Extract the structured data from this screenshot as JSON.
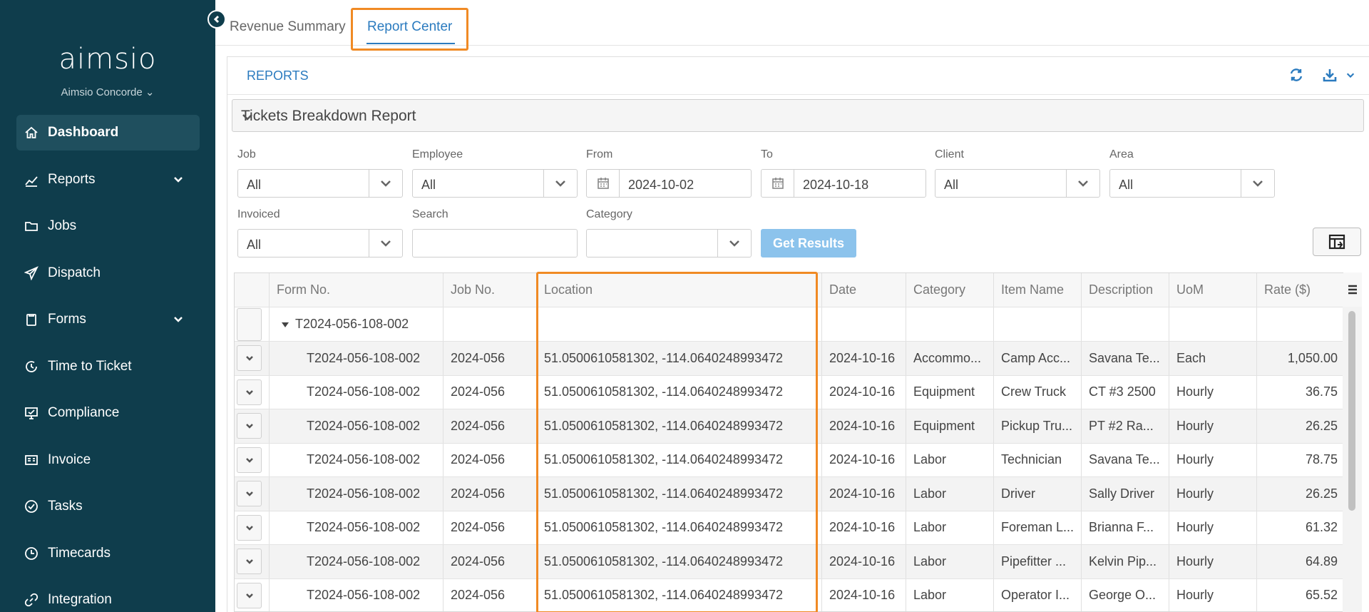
{
  "app": {
    "logo": "aimsio",
    "org": "Aimsio Concorde ⌄"
  },
  "sidebar": {
    "items": [
      {
        "label": "Dashboard",
        "icon": "home-icon",
        "active": true
      },
      {
        "label": "Reports",
        "icon": "chart-icon",
        "expandable": true
      },
      {
        "label": "Jobs",
        "icon": "folder-icon"
      },
      {
        "label": "Dispatch",
        "icon": "send-icon"
      },
      {
        "label": "Forms",
        "icon": "clipboard-icon",
        "expandable": true
      },
      {
        "label": "Time to Ticket",
        "icon": "clock-arrow-icon"
      },
      {
        "label": "Compliance",
        "icon": "monitor-check-icon"
      },
      {
        "label": "Invoice",
        "icon": "invoice-icon"
      },
      {
        "label": "Tasks",
        "icon": "check-circle-icon"
      },
      {
        "label": "Timecards",
        "icon": "clock-icon"
      },
      {
        "label": "Integration",
        "icon": "link-icon"
      }
    ]
  },
  "tabs": {
    "t1": "Revenue Summary",
    "t2": "Report Center"
  },
  "panel": {
    "title": "REPORTS",
    "report": "Tickets Breakdown Report"
  },
  "filters": {
    "job": {
      "label": "Job",
      "value": "All"
    },
    "employee": {
      "label": "Employee",
      "value": "All"
    },
    "from": {
      "label": "From",
      "value": "2024-10-02"
    },
    "to": {
      "label": "To",
      "value": "2024-10-18"
    },
    "client": {
      "label": "Client",
      "value": "All"
    },
    "area": {
      "label": "Area",
      "value": "All"
    },
    "invoiced": {
      "label": "Invoiced",
      "value": "All"
    },
    "search": {
      "label": "Search",
      "value": ""
    },
    "category": {
      "label": "Category",
      "value": ""
    },
    "button": "Get Results"
  },
  "grid": {
    "headers": [
      "Form No.",
      "Job No.",
      "Location",
      "Date",
      "Category",
      "Item Name",
      "Description",
      "UoM",
      "Rate ($)"
    ],
    "group": "T2024-056-108-002",
    "rows": [
      [
        "T2024-056-108-002",
        "2024-056",
        "51.0500610581302, -114.0640248993472",
        "2024-10-16",
        "Accommo...",
        "Camp Acc...",
        "Savana Te...",
        "Each",
        "1,050.00"
      ],
      [
        "T2024-056-108-002",
        "2024-056",
        "51.0500610581302, -114.0640248993472",
        "2024-10-16",
        "Equipment",
        "Crew Truck",
        "CT #3 2500",
        "Hourly",
        "36.75"
      ],
      [
        "T2024-056-108-002",
        "2024-056",
        "51.0500610581302, -114.0640248993472",
        "2024-10-16",
        "Equipment",
        "Pickup Tru...",
        "PT #2 Ra...",
        "Hourly",
        "26.25"
      ],
      [
        "T2024-056-108-002",
        "2024-056",
        "51.0500610581302, -114.0640248993472",
        "2024-10-16",
        "Labor",
        "Technician",
        "Savana Te...",
        "Hourly",
        "78.75"
      ],
      [
        "T2024-056-108-002",
        "2024-056",
        "51.0500610581302, -114.0640248993472",
        "2024-10-16",
        "Labor",
        "Driver",
        "Sally Driver",
        "Hourly",
        "26.25"
      ],
      [
        "T2024-056-108-002",
        "2024-056",
        "51.0500610581302, -114.0640248993472",
        "2024-10-16",
        "Labor",
        "Foreman L...",
        "Brianna F...",
        "Hourly",
        "61.32"
      ],
      [
        "T2024-056-108-002",
        "2024-056",
        "51.0500610581302, -114.0640248993472",
        "2024-10-16",
        "Labor",
        "Pipefitter ...",
        "Kelvin Pip...",
        "Hourly",
        "64.89"
      ],
      [
        "T2024-056-108-002",
        "2024-056",
        "51.0500610581302, -114.0640248993472",
        "2024-10-16",
        "Labor",
        "Operator I...",
        "George O...",
        "Hourly",
        "65.52"
      ]
    ]
  },
  "colors": {
    "sidebar": "#0f3d4c",
    "accent": "#2b7bbf",
    "highlight": "#f08a24",
    "button": "#8cc3ec"
  }
}
